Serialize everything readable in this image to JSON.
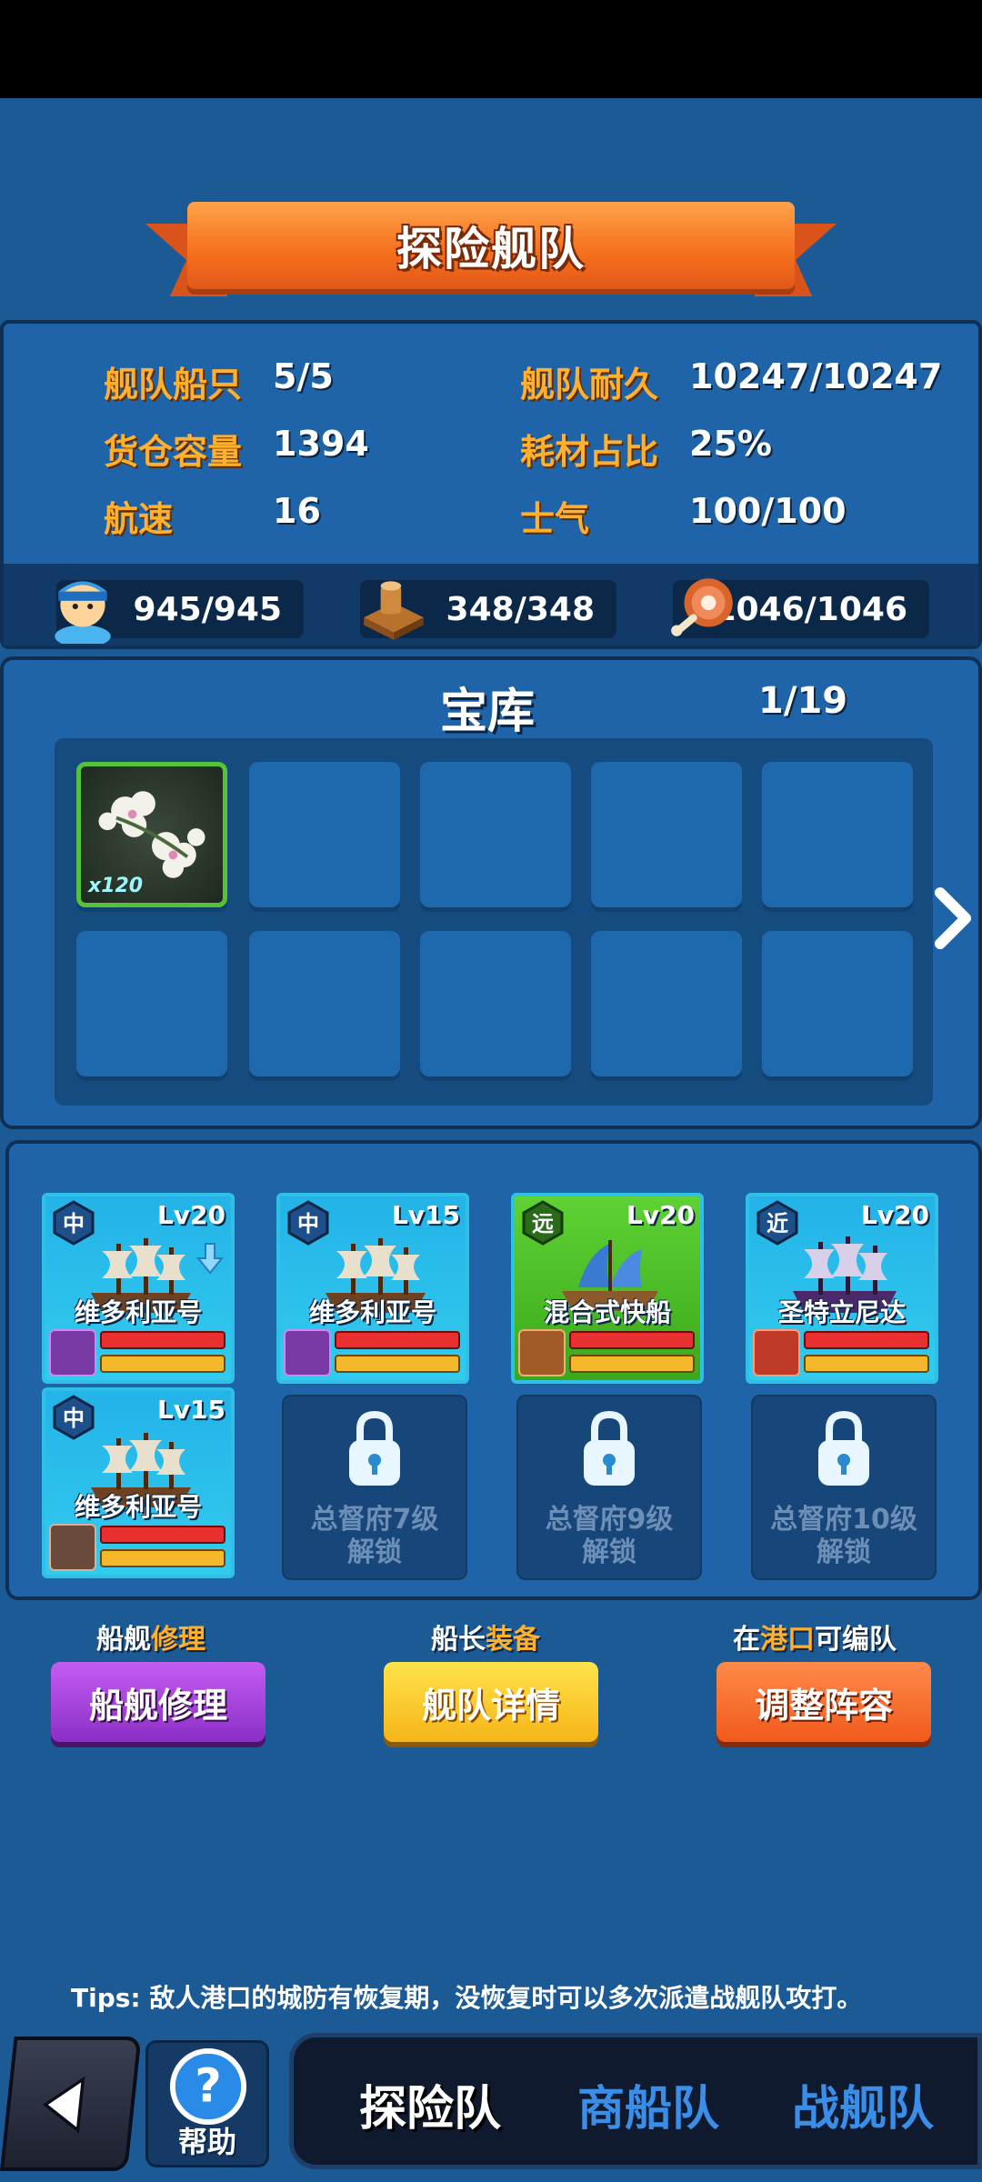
{
  "title": "探险舰队",
  "stats": {
    "ships_label": "舰队船只",
    "ships_value": "5/5",
    "durability_label": "舰队耐久",
    "durability_value": "10247/10247",
    "cargo_label": "货仓容量",
    "cargo_value": "1394",
    "consumable_label": "耗材占比",
    "consumable_value": "25%",
    "speed_label": "航速",
    "speed_value": "16",
    "morale_label": "士气",
    "morale_value": "100/100"
  },
  "resources": {
    "crew": "945/945",
    "wood": "348/348",
    "food": "1046/1046"
  },
  "vault": {
    "title": "宝库",
    "count": "1/19",
    "item_qty": "x120"
  },
  "ships": [
    {
      "class": "中",
      "level": "Lv20",
      "name": "维多利亚号"
    },
    {
      "class": "中",
      "level": "Lv15",
      "name": "维多利亚号"
    },
    {
      "class": "远",
      "level": "Lv20",
      "name": "混合式快船"
    },
    {
      "class": "近",
      "level": "Lv20",
      "name": "圣特立尼达"
    },
    {
      "class": "中",
      "level": "Lv15",
      "name": "维多利亚号"
    }
  ],
  "locked_slots": [
    {
      "line1": "总督府7级",
      "line2": "解锁"
    },
    {
      "line1": "总督府9级",
      "line2": "解锁"
    },
    {
      "line1": "总督府10级",
      "line2": "解锁"
    }
  ],
  "hints": {
    "repair_a": "船舰",
    "repair_b": "修理",
    "equip_a": "船长",
    "equip_b": "装备",
    "port_a": "在",
    "port_b": "港口",
    "port_c": "可编队"
  },
  "buttons": {
    "repair": "船舰修理",
    "details": "舰队详情",
    "adjust": "调整阵容"
  },
  "tips": "Tips: 敌人港口的城防有恢复期，没恢复时可以多次派遣战舰队攻打。",
  "nav": {
    "help": "帮助",
    "tabs": [
      "探险队",
      "商船队",
      "战舰队"
    ]
  },
  "colors": {
    "accent_orange": "#f56f1c",
    "label_gold": "#ffb02e",
    "panel_blue": "#1f63a8",
    "tab_inactive": "#3a8ee8"
  }
}
